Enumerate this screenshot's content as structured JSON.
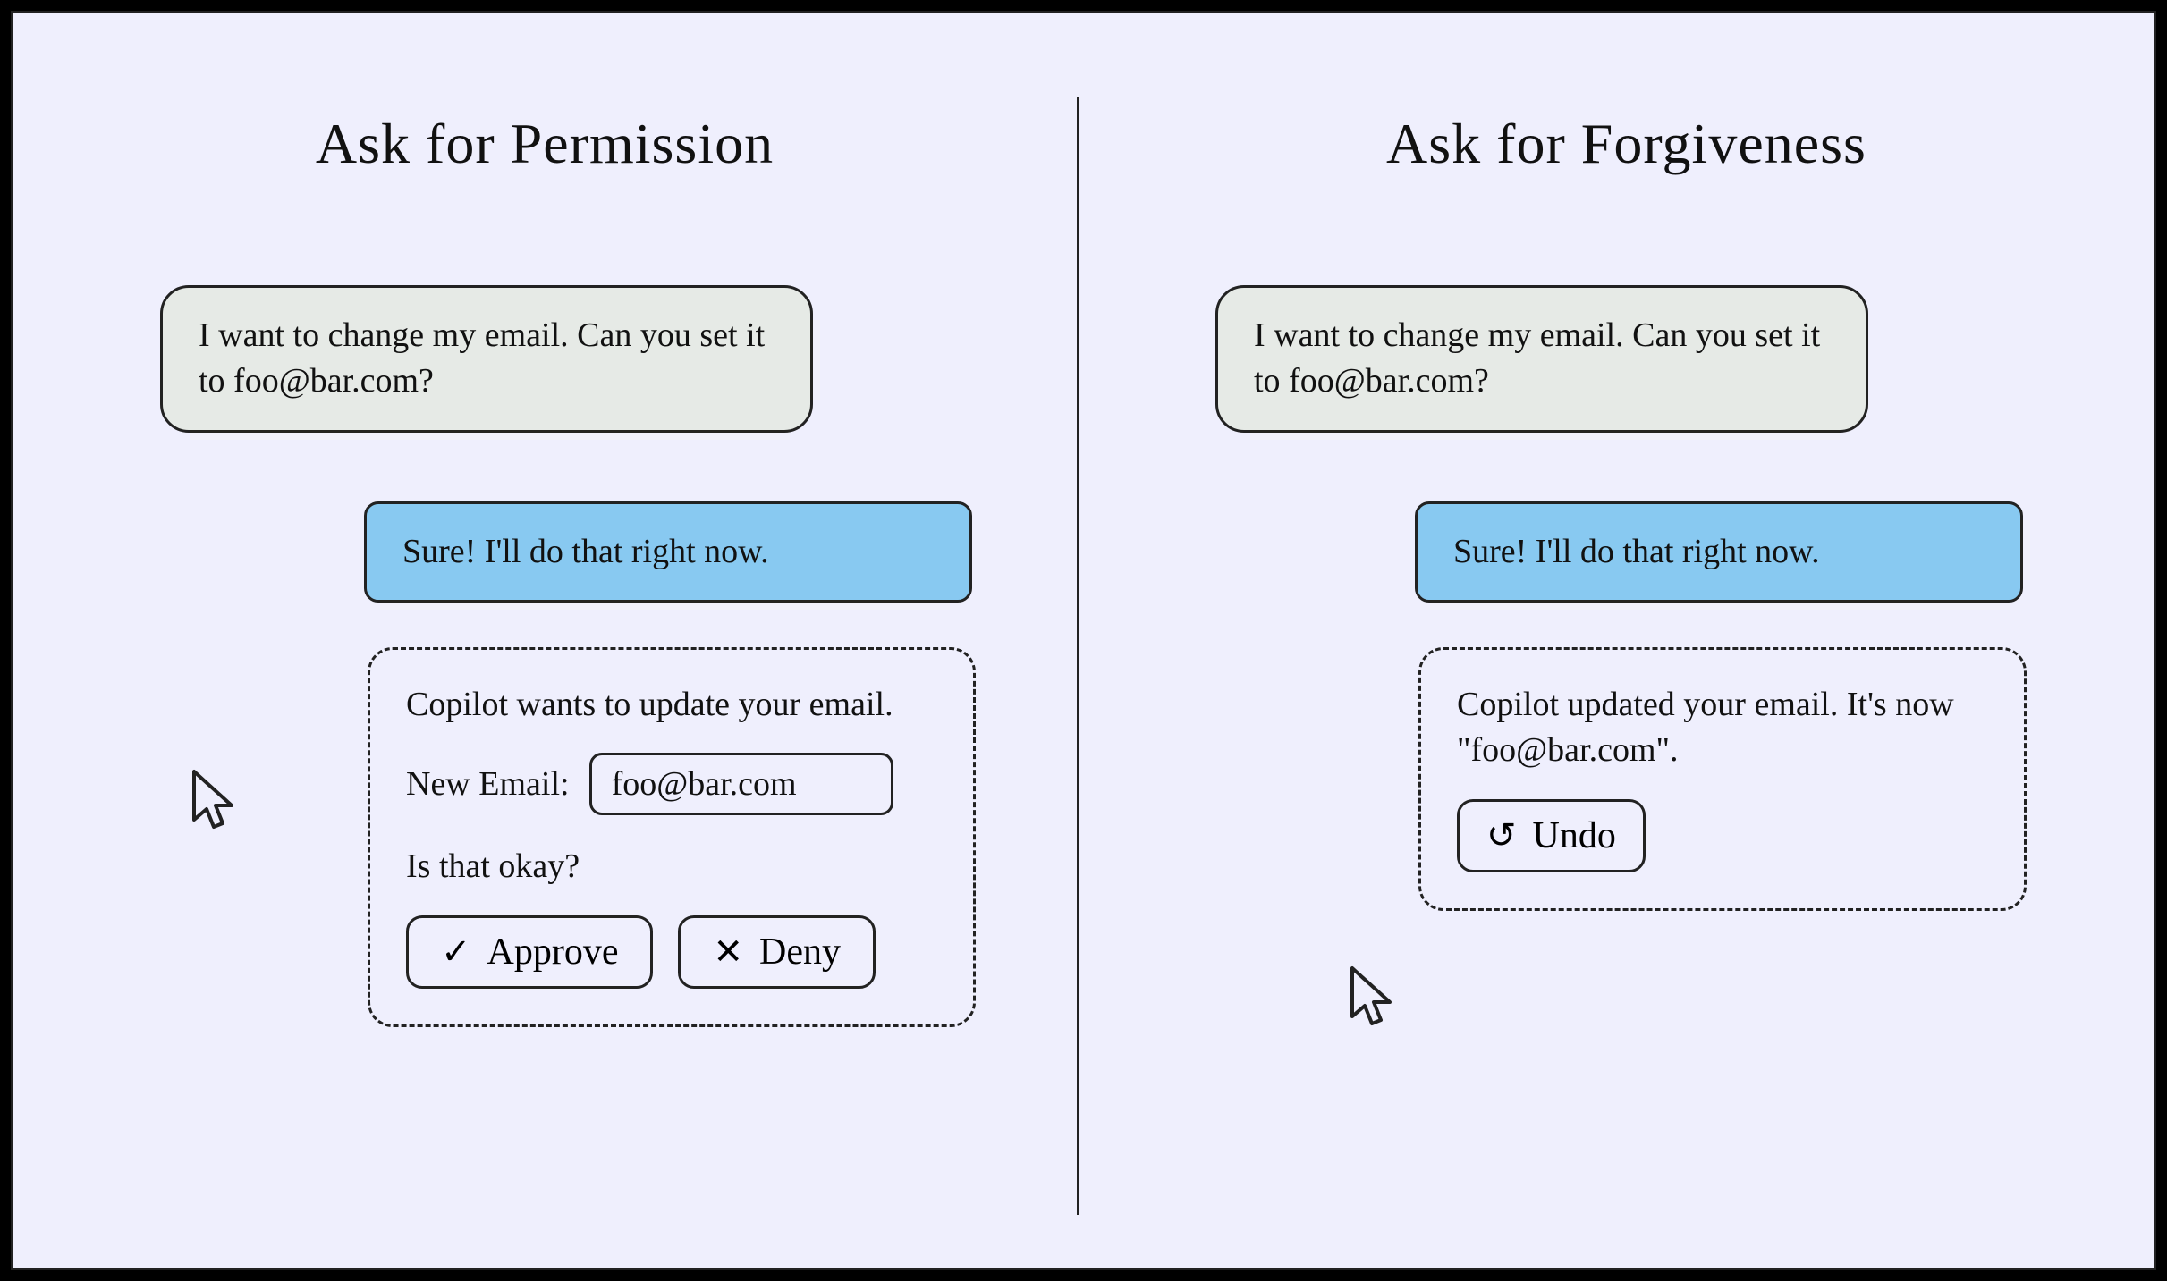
{
  "left": {
    "title": "Ask for Permission",
    "user_message": "I want to change my email. Can you set it to foo@bar.com?",
    "assistant_message": "Sure! I'll do that right now.",
    "system": {
      "line1": "Copilot wants to update your email.",
      "field_label": "New Email:",
      "field_value": "foo@bar.com",
      "line2": "Is that okay?",
      "approve_label": "Approve",
      "deny_label": "Deny"
    }
  },
  "right": {
    "title": "Ask for Forgiveness",
    "user_message": "I want to change my email. Can you set it to foo@bar.com?",
    "assistant_message": "Sure! I'll do that right now.",
    "system": {
      "line1": "Copilot updated your email. It's now \"foo@bar.com\".",
      "undo_label": "Undo"
    }
  }
}
